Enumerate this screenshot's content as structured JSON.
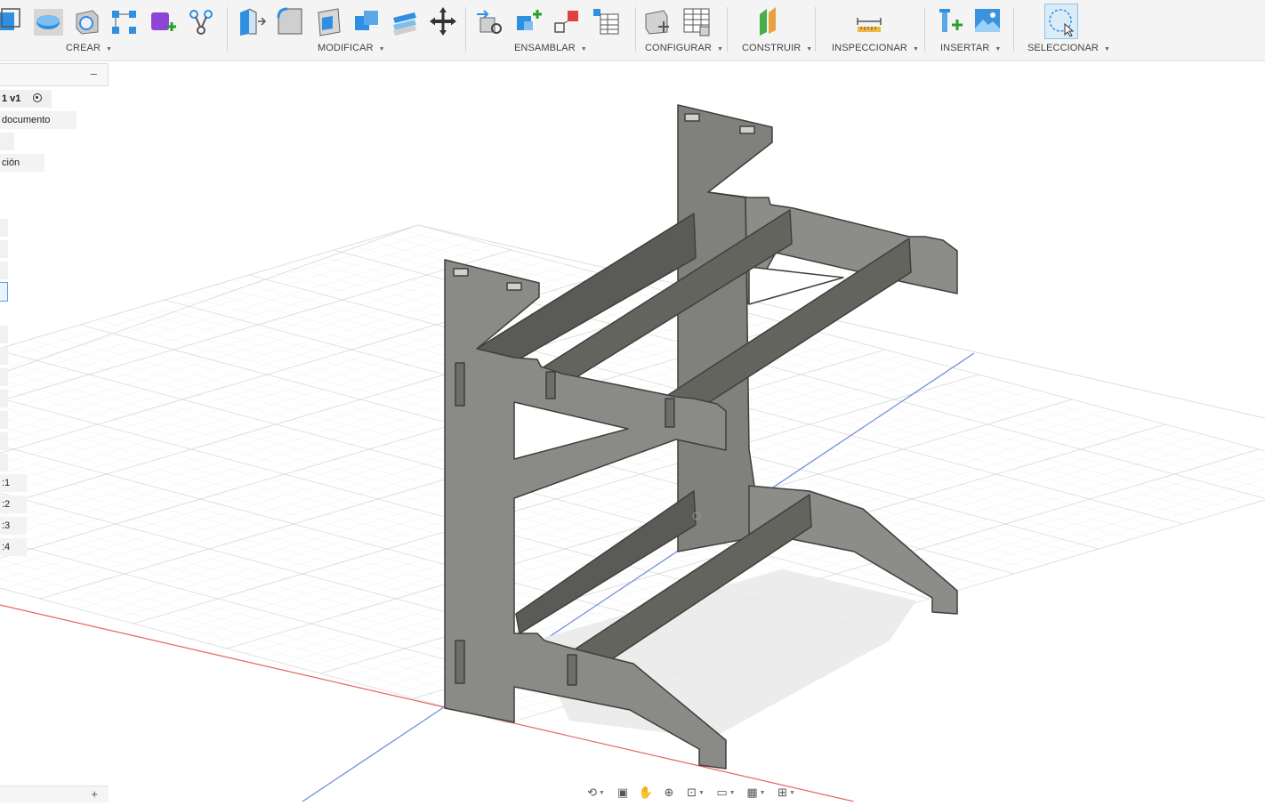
{
  "toolbar": {
    "groups": [
      {
        "label": "CREAR"
      },
      {
        "label": "MODIFICAR"
      },
      {
        "label": "ENSAMBLAR"
      },
      {
        "label": "CONFIGURAR"
      },
      {
        "label": "CONSTRUIR"
      },
      {
        "label": "INSPECCIONAR"
      },
      {
        "label": "INSERTAR"
      },
      {
        "label": "SELECCIONAR"
      }
    ]
  },
  "browser": {
    "component_name": "1 v1",
    "document_settings": "documento",
    "named_views": "ción",
    "components": [
      ":1",
      ":2",
      ":3",
      ":4"
    ]
  },
  "colors": {
    "accent": "#1a8fd6",
    "part_face": "#8a8a86",
    "part_edge": "#4d4d49",
    "x_axis": "#e04040",
    "z_axis": "#4a6ee0"
  }
}
